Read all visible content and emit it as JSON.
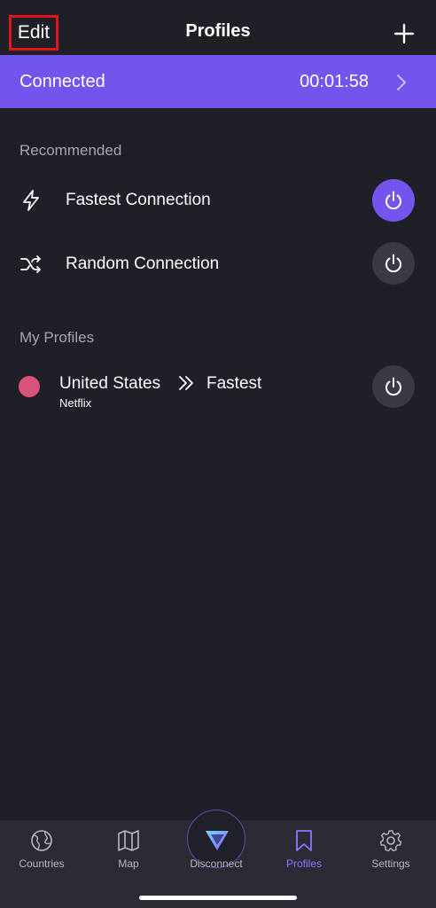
{
  "header": {
    "edit_label": "Edit",
    "title": "Profiles",
    "add_icon": "plus-icon"
  },
  "connection_bar": {
    "status": "Connected",
    "timer": "00:01:58"
  },
  "recommended": {
    "title": "Recommended",
    "items": [
      {
        "label": "Fastest Connection",
        "icon": "lightning-icon",
        "active": true
      },
      {
        "label": "Random Connection",
        "icon": "shuffle-icon",
        "active": false
      }
    ]
  },
  "my_profiles": {
    "title": "My Profiles",
    "items": [
      {
        "name": "United States",
        "destination": "Fastest",
        "subtitle": "Netflix",
        "dot_color": "#d9537a",
        "active": false
      }
    ]
  },
  "tabbar": {
    "tabs": [
      {
        "label": "Countries",
        "icon": "globe-icon"
      },
      {
        "label": "Map",
        "icon": "map-icon"
      },
      {
        "label": "Disconnect",
        "icon": "proton-logo-icon"
      },
      {
        "label": "Profiles",
        "icon": "bookmark-icon",
        "active": true
      },
      {
        "label": "Settings",
        "icon": "gear-icon"
      }
    ]
  },
  "colors": {
    "accent": "#7354ec",
    "background": "#1f1f28",
    "tabbar": "#2b2b36",
    "profile_dot": "#d9537a",
    "active_tab": "#8f78ff"
  }
}
